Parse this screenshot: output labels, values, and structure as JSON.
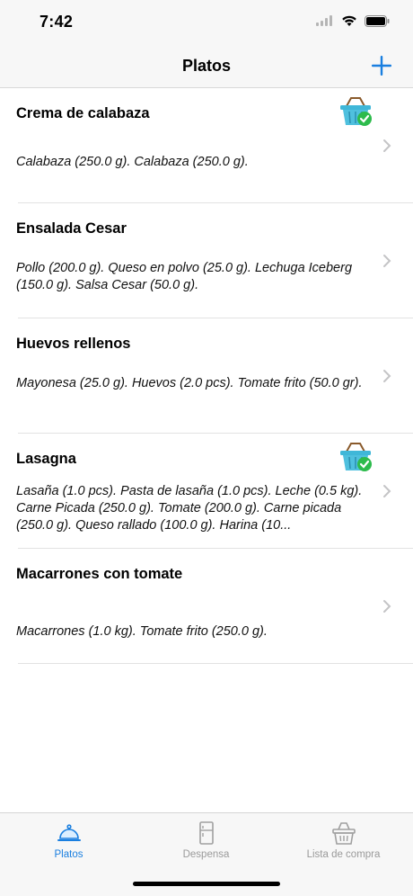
{
  "status_bar": {
    "time": "7:42"
  },
  "nav": {
    "title": "Platos",
    "add_icon": "plus-icon"
  },
  "colors": {
    "accent": "#1a7fe0",
    "inactive": "#9a9a9a",
    "basket": "#3fb7d8",
    "check": "#2dbb4c"
  },
  "dishes": [
    {
      "name": "Crema de calabaza",
      "ingredients": "Calabaza (250.0 g). Calabaza (250.0 g).",
      "in_shopping_list": true
    },
    {
      "name": "Ensalada Cesar",
      "ingredients": "Pollo (200.0 g). Queso en polvo (25.0 g). Lechuga Iceberg (150.0 g). Salsa Cesar (50.0 g).",
      "in_shopping_list": false
    },
    {
      "name": "Huevos rellenos",
      "ingredients": "Mayonesa (25.0 g). Huevos (2.0 pcs). Tomate frito (50.0 gr).",
      "in_shopping_list": false
    },
    {
      "name": "Lasagna",
      "ingredients": "Lasaña (1.0 pcs). Pasta de lasaña (1.0 pcs). Leche (0.5 kg). Carne Picada (250.0 g). Tomate (200.0 g). Carne picada (250.0 g). Queso rallado (100.0 g). Harina (10...",
      "in_shopping_list": true
    },
    {
      "name": "Macarrones con tomate",
      "ingredients": "Macarrones (1.0 kg). Tomate frito (250.0 g).",
      "in_shopping_list": false
    }
  ],
  "tabs": [
    {
      "label": "Platos",
      "icon": "cloche-icon",
      "active": true
    },
    {
      "label": "Despensa",
      "icon": "fridge-icon",
      "active": false
    },
    {
      "label": "Lista de compra",
      "icon": "basket-icon",
      "active": false
    }
  ]
}
